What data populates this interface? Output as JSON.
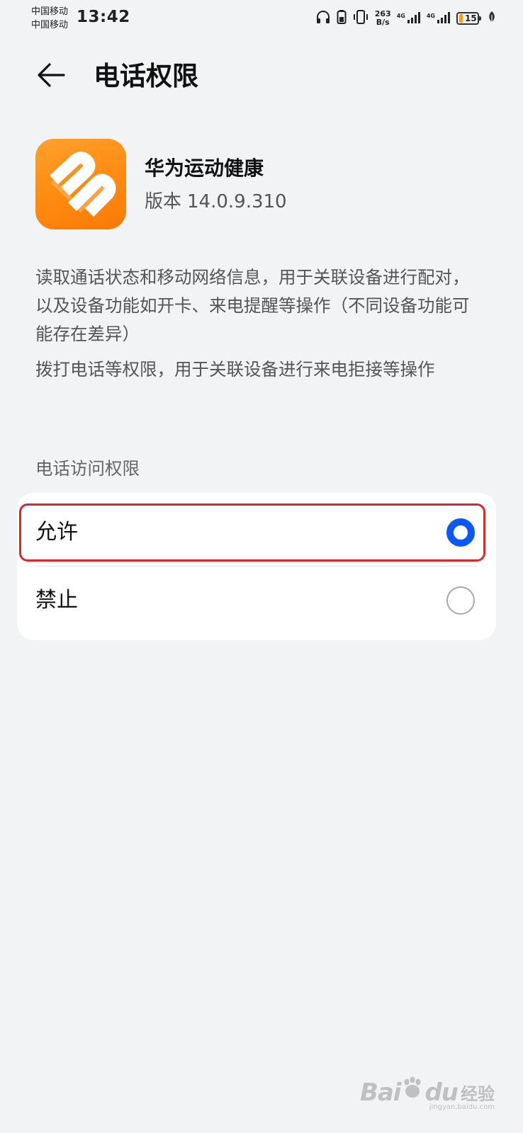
{
  "status_bar": {
    "carrier_1": "中国移动",
    "carrier_2": "中国移动",
    "time": "13:42",
    "net_speed_value": "263",
    "net_speed_unit": "B/s",
    "sim1_network": "4G",
    "sim2_network": "4G",
    "battery_level": "15",
    "icons": [
      "headphones-icon",
      "battery-saver-icon",
      "vibrate-icon",
      "signal-icon",
      "signal-icon",
      "battery-icon",
      "leaf-icon"
    ]
  },
  "header": {
    "back_icon": "arrow-left-icon",
    "title": "电话权限"
  },
  "app": {
    "name": "华为运动健康",
    "version_label": "版本",
    "version": "14.0.9.310",
    "icon": "huawei-health-icon",
    "icon_color": "#ff8d14"
  },
  "description": {
    "paragraph_1": "读取通话状态和移动网络信息，用于关联设备进行配对，以及设备功能如开卡、来电提醒等操作（不同设备功能可能存在差异）",
    "paragraph_2": "拨打电话等权限，用于关联设备进行来电拒接等操作"
  },
  "section": {
    "title": "电话访问权限"
  },
  "options": [
    {
      "label": "允许",
      "selected": true
    },
    {
      "label": "禁止",
      "selected": false
    }
  ],
  "colors": {
    "accent": "#0a59f7",
    "highlight": "#d42a2f",
    "background": "#f1f3f5"
  },
  "watermark": {
    "brand": "Bai",
    "brand_suffix": "du",
    "cn": "经验",
    "url": "jingyan.baidu.com"
  }
}
